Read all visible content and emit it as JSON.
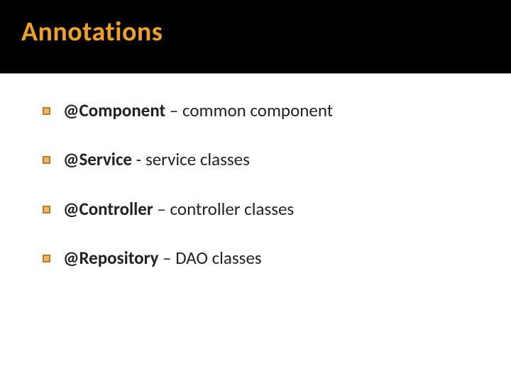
{
  "slide": {
    "title": "Annotations",
    "bullets": [
      {
        "bold": "@Component",
        "sep": " – ",
        "rest": "common component"
      },
      {
        "bold": "@Service",
        "sep": "  - ",
        "rest": "service classes"
      },
      {
        "bold": "@Controller",
        "sep": " – ",
        "rest": "controller classes"
      },
      {
        "bold": "@Repository",
        "sep": " – ",
        "rest": "DAO classes"
      }
    ]
  },
  "colors": {
    "title_bg": "#000000",
    "title_fg": "#f0a21f",
    "bullet_border": "#c77915",
    "bullet_fill": "#e6b87a",
    "text": "#222222"
  }
}
